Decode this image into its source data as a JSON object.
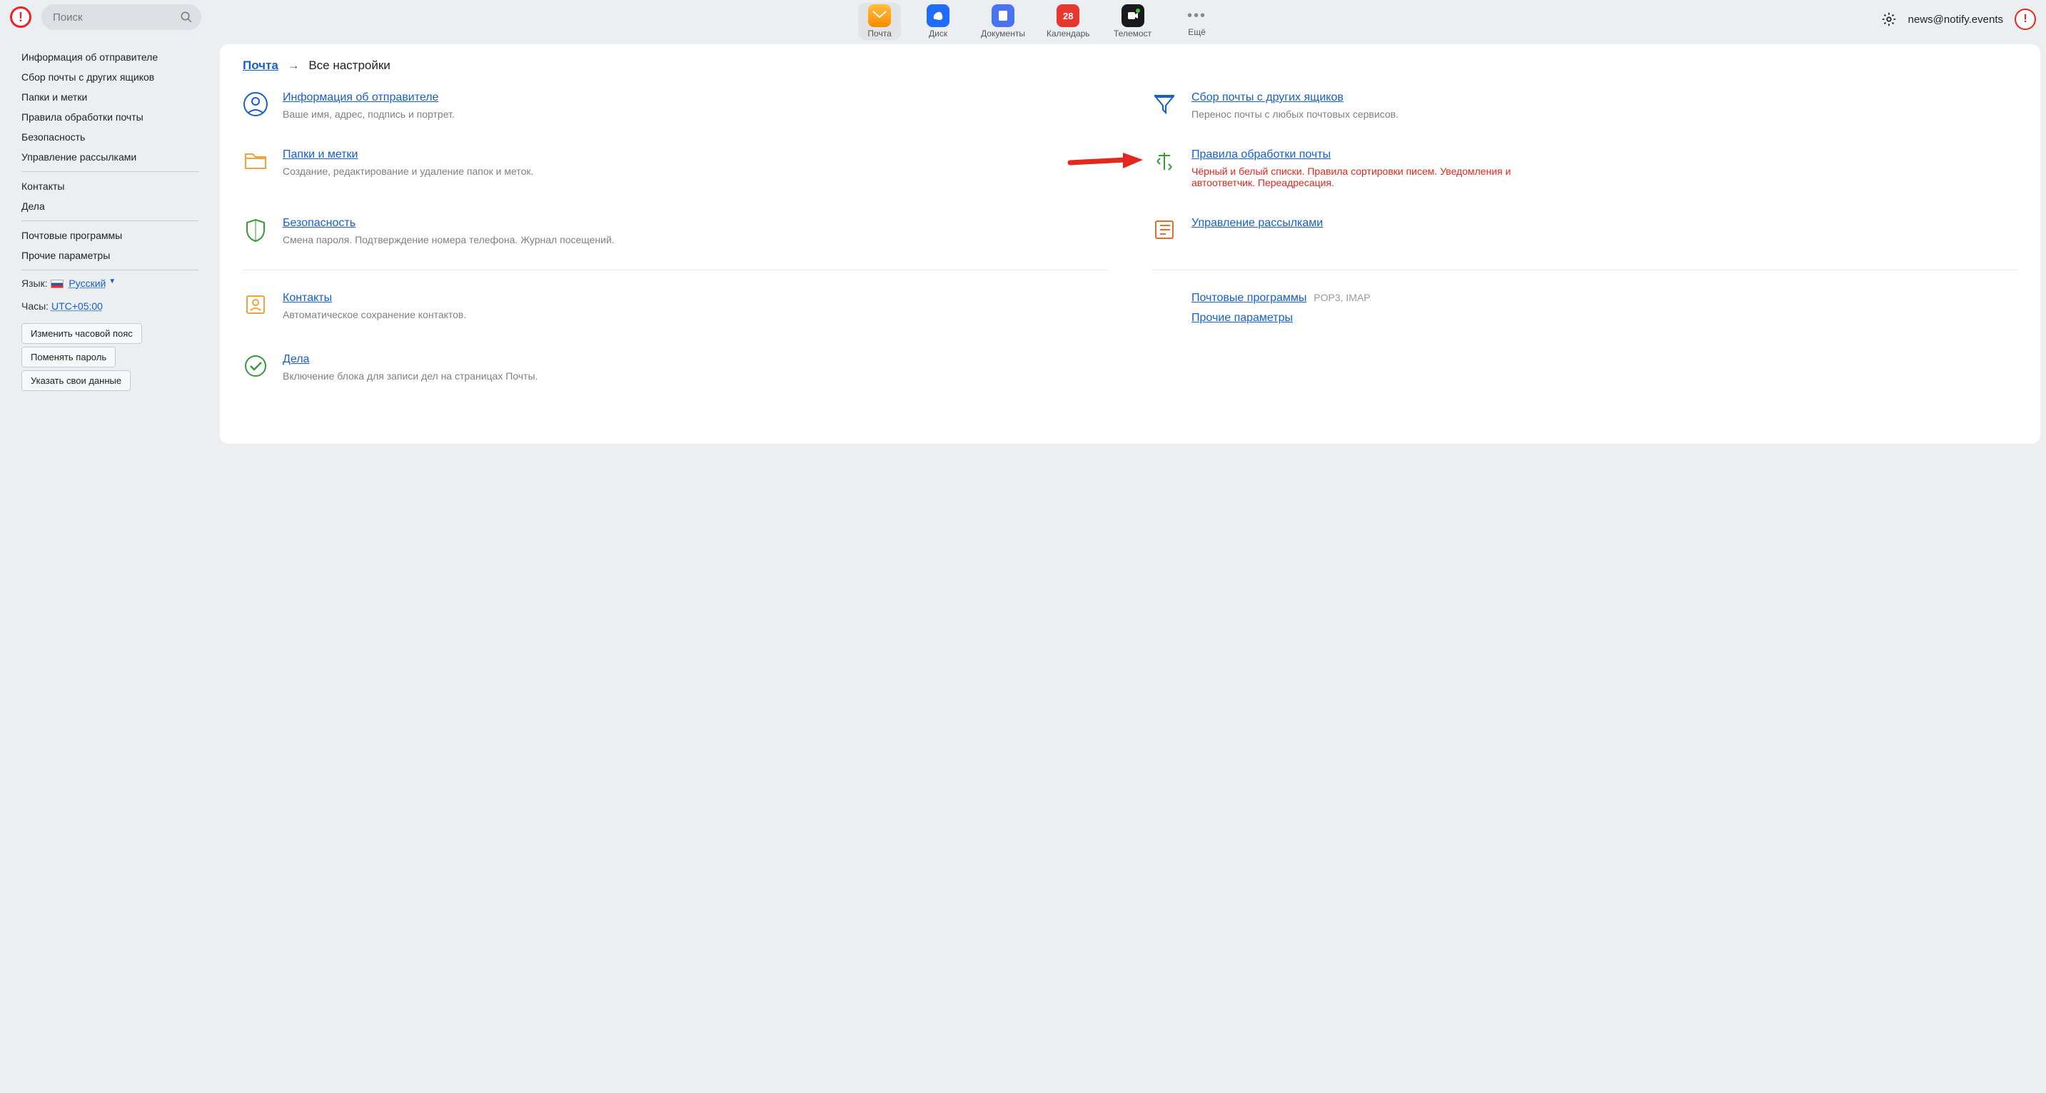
{
  "header": {
    "search_placeholder": "Поиск",
    "user_email": "news@notify.events"
  },
  "services": [
    {
      "key": "mail",
      "label": "Почта",
      "active": true
    },
    {
      "key": "disk",
      "label": "Диск"
    },
    {
      "key": "docs",
      "label": "Документы"
    },
    {
      "key": "cal",
      "label": "Календарь",
      "badge": "28"
    },
    {
      "key": "tele",
      "label": "Телемост"
    },
    {
      "key": "more",
      "label": "Ещё"
    }
  ],
  "sidebar": {
    "group1": [
      "Информация об отправителе",
      "Сбор почты с других ящиков",
      "Папки и метки",
      "Правила обработки почты",
      "Безопасность",
      "Управление рассылками"
    ],
    "group2": [
      "Контакты",
      "Дела"
    ],
    "group3": [
      "Почтовые программы",
      "Прочие параметры"
    ],
    "lang_label": "Язык:",
    "lang_value": "Русский",
    "clock_label": "Часы:",
    "clock_value": "UTC+05:00",
    "btn_tz": "Изменить часовой пояс",
    "btn_pw": "Поменять пароль",
    "btn_data": "Указать свои данные"
  },
  "breadcrumb": {
    "root": "Почта",
    "current": "Все настройки"
  },
  "cards": {
    "sender": {
      "title": "Информация об отправителе",
      "desc": "Ваше имя, адрес, подпись и портрет."
    },
    "collect": {
      "title": "Сбор почты с других ящиков",
      "desc": "Перенос почты с любых почтовых сервисов."
    },
    "folders": {
      "title": "Папки и метки",
      "desc": "Создание, редактирование и удаление папок и меток."
    },
    "rules": {
      "title": "Правила обработки почты",
      "desc": "Чёрный и белый списки. Правила сортировки писем. Уведомления и автоответчик. Переадресация."
    },
    "security": {
      "title": "Безопасность",
      "desc": "Смена пароля. Подтверждение номера телефона. Журнал посещений."
    },
    "subs": {
      "title": "Управление рассылками"
    },
    "contacts": {
      "title": "Контакты",
      "desc": "Автоматическое сохранение контактов."
    },
    "clients": {
      "title": "Почтовые программы",
      "extra": "POP3, IMAP"
    },
    "other": {
      "title": "Прочие параметры"
    },
    "todo": {
      "title": "Дела",
      "desc": "Включение блока для записи дел на страницах Почты."
    }
  }
}
